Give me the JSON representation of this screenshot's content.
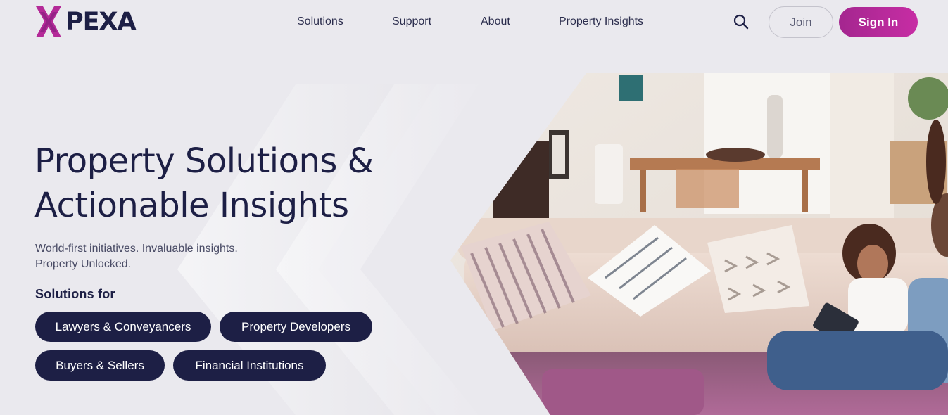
{
  "brand": {
    "name": "PEXA",
    "accent": "#b42a98",
    "navy": "#1d1f45"
  },
  "nav": {
    "items": [
      "Solutions",
      "Support",
      "About",
      "Property Insights"
    ],
    "search_icon": "search-icon",
    "join_label": "Join",
    "signin_label": "Sign In"
  },
  "hero": {
    "title_line1": "Property Solutions &",
    "title_line2": "Actionable Insights",
    "subtitle_line1": "World-first initiatives. Invaluable insights.",
    "subtitle_line2": "Property Unlocked.",
    "solutions_heading": "Solutions for",
    "solutions": [
      "Lawyers & Conveyancers",
      "Property Developers",
      "Buyers & Sellers",
      "Financial Institutions"
    ]
  }
}
